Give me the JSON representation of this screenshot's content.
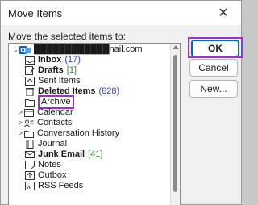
{
  "window": {
    "title": "Move Items",
    "close_glyph": "✕"
  },
  "prompt": "Move the selected items to:",
  "tree": {
    "account": {
      "label": "████████████nail.com",
      "icon": "outlook-account-icon"
    },
    "items": [
      {
        "label": "Inbox",
        "count": "(17)",
        "bold": true,
        "count_color": "blue",
        "icon": "inbox-icon",
        "expand": ""
      },
      {
        "label": "Drafts",
        "count": "[1]",
        "bold": true,
        "count_color": "green",
        "icon": "drafts-icon",
        "expand": ""
      },
      {
        "label": "Sent Items",
        "count": "",
        "bold": false,
        "icon": "sent-items-icon",
        "expand": ""
      },
      {
        "label": "Deleted Items",
        "count": "(828)",
        "bold": true,
        "count_color": "blue",
        "icon": "trash-icon",
        "expand": ""
      },
      {
        "label": "Archive",
        "count": "",
        "bold": false,
        "icon": "folder-icon",
        "expand": "",
        "selected": true
      },
      {
        "label": "Calendar",
        "count": "",
        "bold": false,
        "icon": "calendar-icon",
        "expand": ">"
      },
      {
        "label": "Contacts",
        "count": "",
        "bold": false,
        "icon": "contacts-icon",
        "expand": ">"
      },
      {
        "label": "Conversation History",
        "count": "",
        "bold": false,
        "icon": "folder-icon",
        "expand": ">"
      },
      {
        "label": "Journal",
        "count": "",
        "bold": false,
        "icon": "journal-icon",
        "expand": ""
      },
      {
        "label": "Junk Email",
        "count": "[41]",
        "bold": true,
        "count_color": "green",
        "icon": "junk-icon",
        "expand": ""
      },
      {
        "label": "Notes",
        "count": "",
        "bold": false,
        "icon": "notes-icon",
        "expand": ""
      },
      {
        "label": "Outbox",
        "count": "",
        "bold": false,
        "icon": "outbox-icon",
        "expand": ""
      },
      {
        "label": "RSS Feeds",
        "count": "",
        "bold": false,
        "icon": "rss-icon",
        "expand": ""
      }
    ]
  },
  "buttons": {
    "ok": "OK",
    "cancel": "Cancel",
    "new": "New..."
  },
  "colors": {
    "highlight": "#9b2fd6",
    "count_blue": "#2d47c4",
    "count_green": "#2e8b2e",
    "accent": "#0067c0"
  }
}
